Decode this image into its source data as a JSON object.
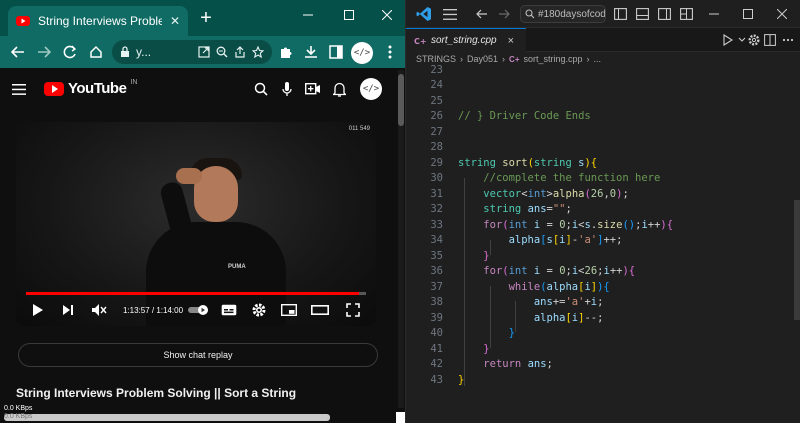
{
  "chrome": {
    "tab_title": "String Interviews Problem Solvi",
    "tab_close": "✕",
    "new_tab": "+",
    "url": "y..."
  },
  "youtube": {
    "logo_text": "YouTube",
    "region": "IN",
    "avatar_text": "</>",
    "video": {
      "watermark": "011 549",
      "shirt_logo": "PUMA",
      "time_display": "1:13:57 / 1:14:00",
      "progress": 0.98
    },
    "chat_replay_label": "Show chat replay",
    "video_title": "String Interviews Problem Solving || Sort a String"
  },
  "status": {
    "net_speed": "0.0 KBps",
    "net_speed_secondary": "0.0 KBps"
  },
  "vscode": {
    "search_text": "#180daysofcod",
    "tab_name": "sort_string.cpp",
    "tab_close": "×",
    "breadcrumb": [
      "STRINGS",
      "Day051",
      "sort_string.cpp",
      "..."
    ],
    "line_numbers": [
      "23",
      "24",
      "25",
      "26",
      "27",
      "28",
      "29",
      "30",
      "31",
      "32",
      "33",
      "34",
      "35",
      "36",
      "37",
      "38",
      "39",
      "40",
      "41",
      "42",
      "43"
    ]
  },
  "colors": {
    "chrome_accent": "#0f6b63",
    "youtube_red": "#ff0000",
    "vscode_bg": "#1f1f1f",
    "vscode_focus": "#0078d4"
  }
}
